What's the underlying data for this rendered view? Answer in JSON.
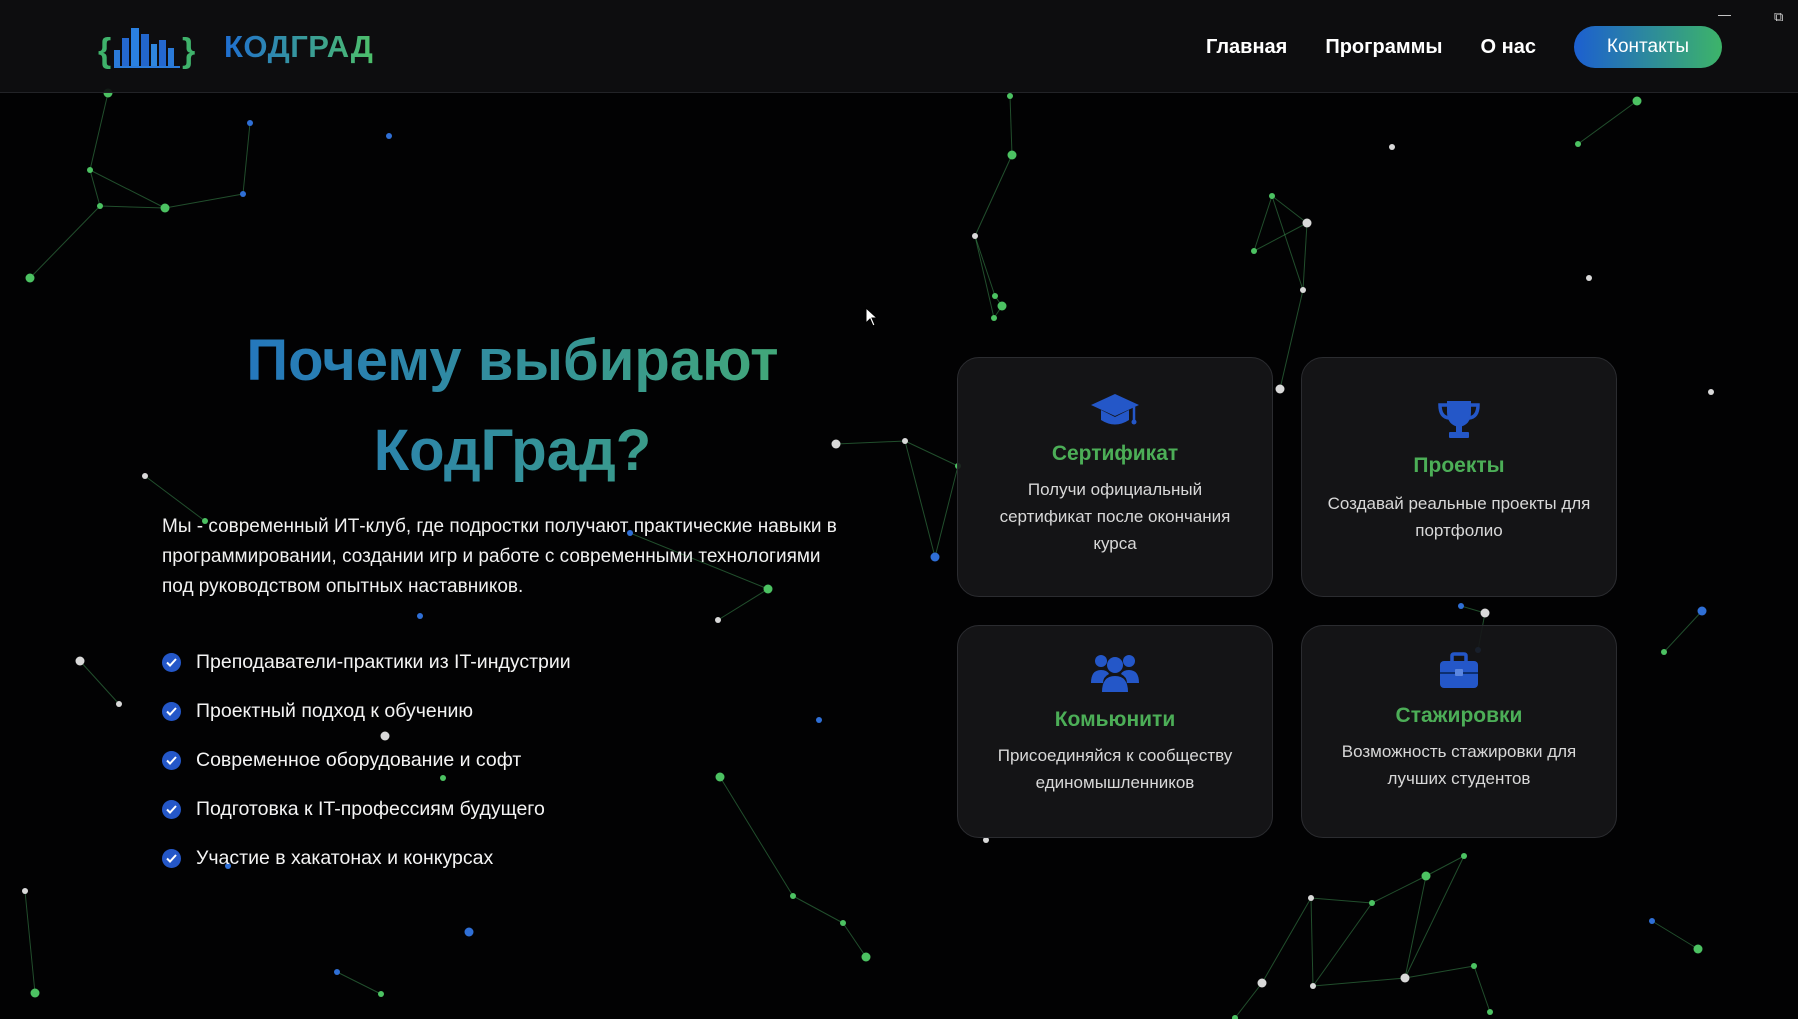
{
  "header": {
    "brand": "КОДГРАД",
    "nav": [
      {
        "label": "Главная"
      },
      {
        "label": "Программы"
      },
      {
        "label": "О нас"
      }
    ],
    "contact_label": "Контакты"
  },
  "window_controls": {
    "minimize": "—",
    "restore": "⧉"
  },
  "hero": {
    "title": "Почему выбирают КодГрад?",
    "description": "Мы - современный ИТ-клуб, где подростки получают практические навыки в программировании, создании игр и работе с современными технологиями под руководством опытных наставников.",
    "features": [
      "Преподаватели-практики из IT-индустрии",
      "Проектный подход к обучению",
      "Современное оборудование и софт",
      "Подготовка к IT-профессиям будущего",
      "Участие в хакатонах и конкурсах"
    ]
  },
  "cards": [
    {
      "icon": "graduation-cap-icon",
      "title": "Сертификат",
      "text": "Получи официальный сертификат после окончания курса"
    },
    {
      "icon": "trophy-icon",
      "title": "Проекты",
      "text": "Создавай реальные проекты для портфолио"
    },
    {
      "icon": "users-icon",
      "title": "Комьюнити",
      "text": "Присоединяйся к сообществу единомышленников"
    },
    {
      "icon": "briefcase-icon",
      "title": "Стажировки",
      "text": "Возможность стажировки для лучших студентов"
    }
  ],
  "colors": {
    "accent_blue": "#1f6fc9",
    "accent_green": "#47b06d",
    "card_title_green": "#4cae57",
    "check_blue": "#2457c8",
    "background": "#020203"
  }
}
